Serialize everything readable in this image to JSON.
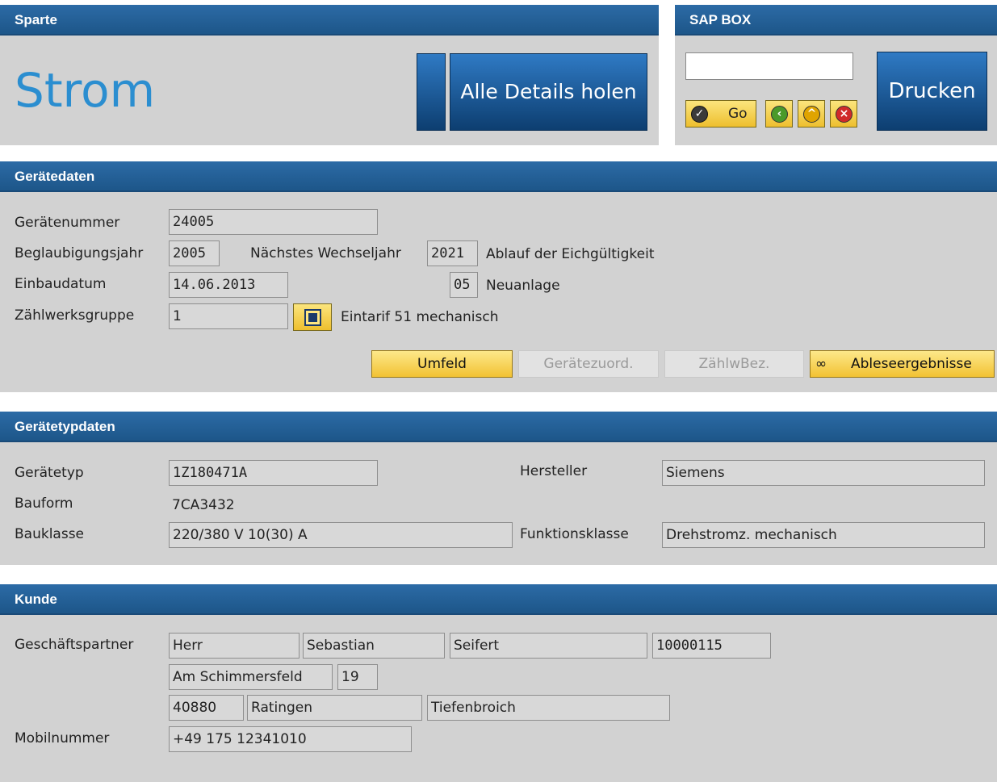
{
  "sparte": {
    "header": "Sparte",
    "value": "Strom",
    "details_button": "Alle Details holen"
  },
  "sapbox": {
    "header": "SAP BOX",
    "input_value": "",
    "go_label": "Go",
    "print_button": "Drucken"
  },
  "geraetedaten": {
    "header": "Gerätedaten",
    "geraetenummer_label": "Gerätenummer",
    "geraetenummer": "24005",
    "beglaubigungsjahr_label": "Beglaubigungsjahr",
    "beglaubigungsjahr": "2005",
    "naechstes_label": "Nächstes Wechseljahr",
    "naechstes_wechseljahr": "2021",
    "ablauf_text": "Ablauf der Eichgültigkeit",
    "einbaudatum_label": "Einbaudatum",
    "einbaudatum": "14.06.2013",
    "code": "05",
    "code_text": "Neuanlage",
    "zaehlwerksgruppe_label": "Zählwerksgruppe",
    "zaehlwerksgruppe": "1",
    "zaehlwerk_text": "Eintarif 51 mechanisch",
    "buttons": {
      "umfeld": "Umfeld",
      "geraetezuord": "Gerätezuord.",
      "zaehlwbez": "ZählwBez.",
      "ableseergebnisse": "Ableseergebnisse"
    }
  },
  "geraetetypdaten": {
    "header": "Gerätetypdaten",
    "geraetetyp_label": "Gerätetyp",
    "geraetetyp": "1Z180471A",
    "hersteller_label": "Hersteller",
    "hersteller": "Siemens",
    "bauform_label": "Bauform",
    "bauform": "7CA3432",
    "bauklasse_label": "Bauklasse",
    "bauklasse": "220/380 V 10(30) A",
    "funktionsklasse_label": "Funktionsklasse",
    "funktionsklasse": "Drehstromz. mechanisch"
  },
  "kunde": {
    "header": "Kunde",
    "partner_label": "Geschäftspartner",
    "anrede": "Herr",
    "vorname": "Sebastian",
    "nachname": "Seifert",
    "partner_nr": "10000115",
    "strasse": "Am Schimmersfeld",
    "hausnr": "19",
    "plz": "40880",
    "ort": "Ratingen",
    "ortsteil": "Tiefenbroich",
    "mobil_label": "Mobilnummer",
    "mobil": "+49 175 12341010"
  },
  "colors": {
    "header_blue": "#1d5689",
    "panel_gray": "#d2d2d2",
    "strom_blue": "#2b8ed0",
    "button_yellow": "#f2c233"
  }
}
